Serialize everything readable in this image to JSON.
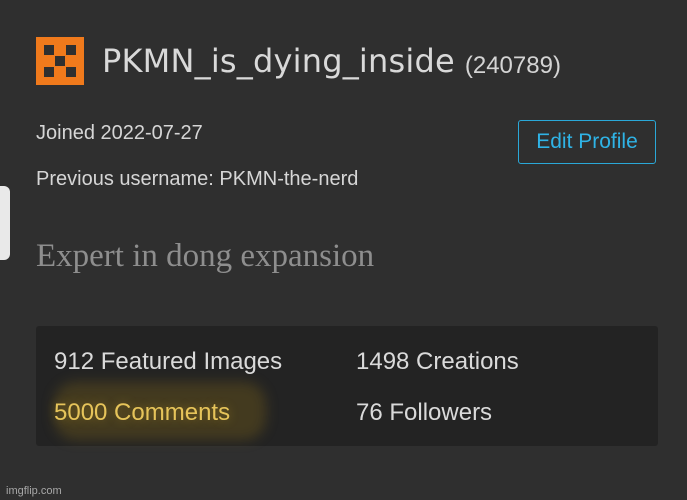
{
  "profile": {
    "username": "PKMN_is_dying_inside",
    "user_id": "(240789)",
    "joined": "Joined 2022-07-27",
    "previous_username": "Previous username: PKMN-the-nerd",
    "bio": "Expert in dong expansion",
    "edit_button_label": "Edit Profile",
    "avatar_color": "#f07a1c",
    "accent_color": "#2fb3e6"
  },
  "stats": {
    "featured_images": "912 Featured Images",
    "creations": "1498 Creations",
    "comments": "5000 Comments",
    "followers": "76 Followers"
  },
  "watermark": "imgflip.com"
}
